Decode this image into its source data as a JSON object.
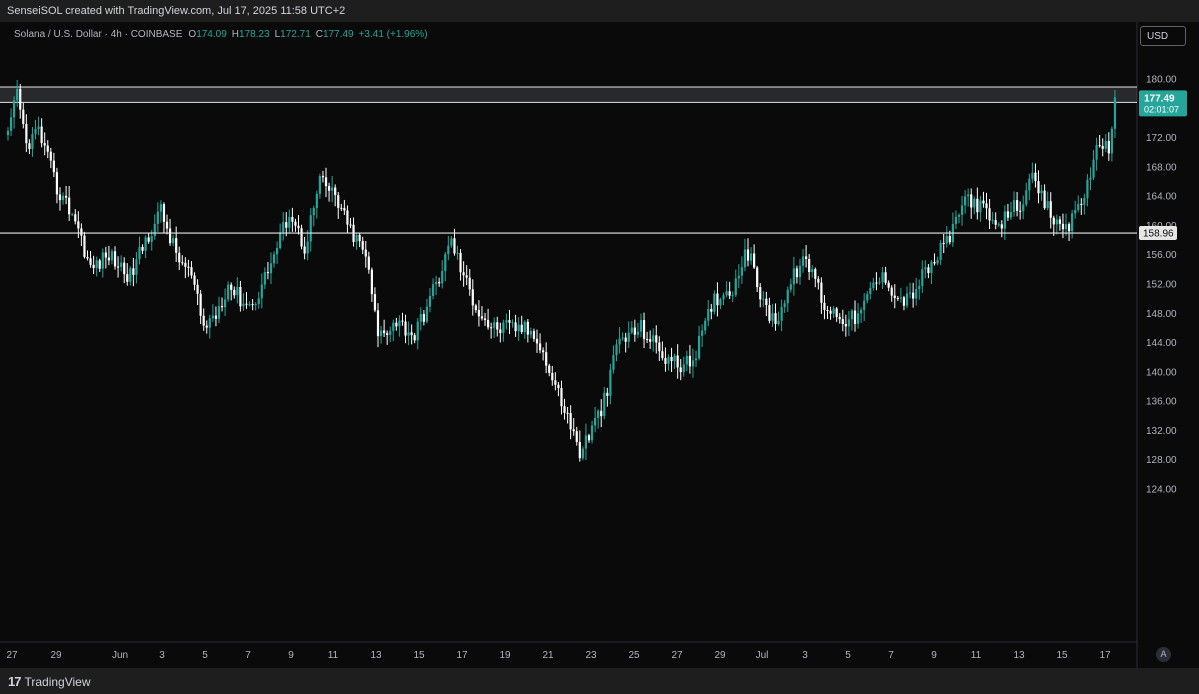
{
  "header": {
    "credit": "SenseiSOL created with TradingView.com, Jul 17, 2025 11:58 UTC+2"
  },
  "legend": {
    "symbol": "Solana / U.S. Dollar · 4h · COINBASE",
    "o_label": "O",
    "o_value": "174.09",
    "h_label": "H",
    "h_value": "178.23",
    "l_label": "L",
    "l_value": "172.71",
    "c_label": "C",
    "c_value": "177.49",
    "change": "+3.41 (+1.96%)"
  },
  "toolbar": {
    "currency": "USD",
    "auto": "A"
  },
  "footer": {
    "brand": "TradingView",
    "brand_mark": "17"
  },
  "chart_data": {
    "type": "candlestick",
    "symbol": "Solana / U.S. Dollar",
    "interval": "4h",
    "exchange": "COINBASE",
    "currency": "USD",
    "ylim": [
      121,
      184
    ],
    "y_ticks": [
      124,
      128,
      132,
      136,
      140,
      144,
      148,
      152,
      156,
      160,
      164,
      168,
      172,
      176,
      180
    ],
    "x_ticks": [
      "27",
      "29",
      "Jun",
      "3",
      "5",
      "7",
      "9",
      "11",
      "13",
      "15",
      "17",
      "19",
      "21",
      "23",
      "25",
      "27",
      "29",
      "Jul",
      "3",
      "5",
      "7",
      "9",
      "11",
      "13",
      "15",
      "17"
    ],
    "last_price": "177.49",
    "countdown": "02:01:07",
    "support_level": "158.96",
    "resistance_zone": [
      176.8,
      178.9
    ],
    "path": [
      [
        0,
        172
      ],
      [
        3,
        178
      ],
      [
        6,
        171
      ],
      [
        10,
        173
      ],
      [
        16,
        165
      ],
      [
        22,
        161
      ],
      [
        27,
        154
      ],
      [
        33,
        156
      ],
      [
        40,
        153
      ],
      [
        45,
        158
      ],
      [
        50,
        162
      ],
      [
        55,
        156
      ],
      [
        60,
        153
      ],
      [
        64,
        146
      ],
      [
        68,
        148
      ],
      [
        72,
        152
      ],
      [
        76,
        150
      ],
      [
        80,
        149
      ],
      [
        84,
        153
      ],
      [
        88,
        157
      ],
      [
        92,
        162
      ],
      [
        97,
        157
      ],
      [
        102,
        166
      ],
      [
        107,
        164
      ],
      [
        111,
        160
      ],
      [
        117,
        156
      ],
      [
        121,
        145
      ],
      [
        127,
        147
      ],
      [
        133,
        145
      ],
      [
        137,
        149
      ],
      [
        141,
        153
      ],
      [
        145,
        158
      ],
      [
        149,
        153
      ],
      [
        153,
        149
      ],
      [
        158,
        146
      ],
      [
        163,
        146
      ],
      [
        168,
        146
      ],
      [
        173,
        145
      ],
      [
        177,
        140
      ],
      [
        182,
        135
      ],
      [
        187,
        129
      ],
      [
        192,
        133
      ],
      [
        196,
        137
      ],
      [
        199,
        144
      ],
      [
        203,
        145
      ],
      [
        207,
        146
      ],
      [
        211,
        144
      ],
      [
        215,
        142
      ],
      [
        219,
        141
      ],
      [
        223,
        141
      ],
      [
        227,
        145
      ],
      [
        231,
        150
      ],
      [
        235,
        151
      ],
      [
        238,
        152
      ],
      [
        241,
        157
      ],
      [
        244,
        154
      ],
      [
        247,
        149
      ],
      [
        251,
        147
      ],
      [
        255,
        151
      ],
      [
        259,
        155
      ],
      [
        263,
        154
      ],
      [
        267,
        149
      ],
      [
        271,
        148
      ],
      [
        275,
        147
      ],
      [
        279,
        148
      ],
      [
        283,
        152
      ],
      [
        287,
        153
      ],
      [
        291,
        150
      ],
      [
        295,
        150
      ],
      [
        299,
        153
      ],
      [
        303,
        155
      ],
      [
        307,
        158
      ],
      [
        310,
        160
      ],
      [
        313,
        164
      ],
      [
        317,
        163
      ],
      [
        321,
        161
      ],
      [
        324,
        159
      ],
      [
        327,
        162
      ],
      [
        331,
        163
      ],
      [
        335,
        166
      ],
      [
        339,
        163
      ],
      [
        343,
        160
      ],
      [
        347,
        160
      ],
      [
        350,
        163
      ],
      [
        354,
        166
      ],
      [
        357,
        172
      ],
      [
        360,
        170
      ],
      [
        362,
        177.49
      ]
    ]
  }
}
